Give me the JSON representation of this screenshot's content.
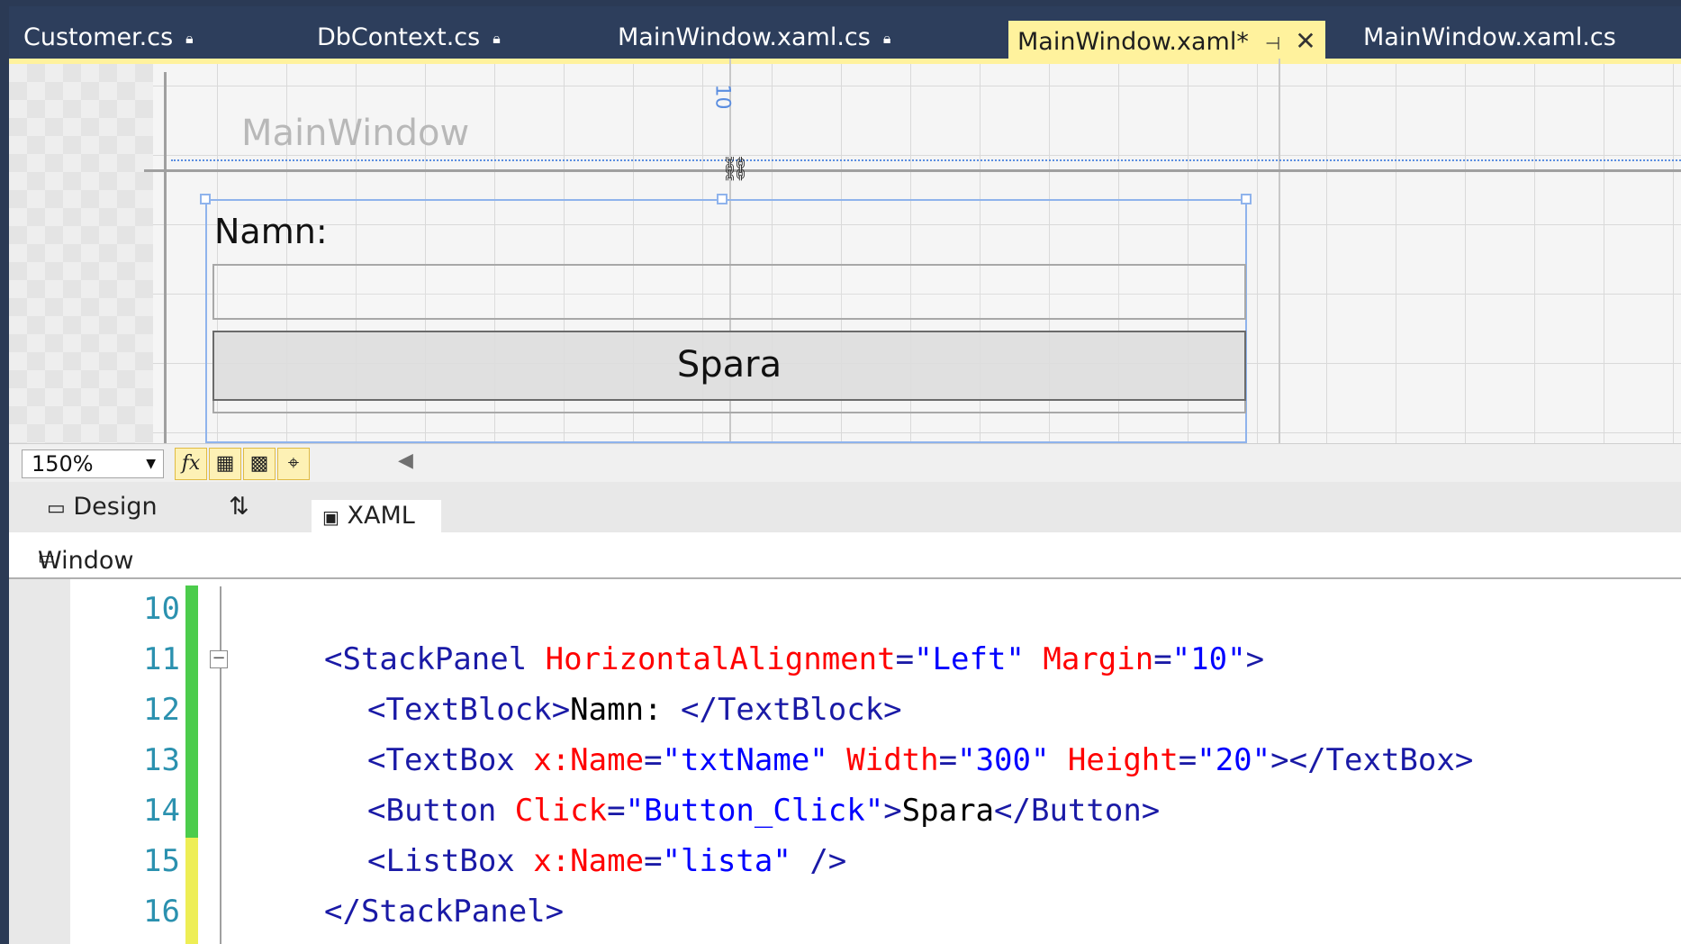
{
  "tabs": [
    {
      "label": "Customer.cs",
      "locked": true,
      "active": false
    },
    {
      "label": "DbContext.cs",
      "locked": true,
      "active": false
    },
    {
      "label": "MainWindow.xaml.cs",
      "locked": true,
      "active": false
    },
    {
      "label": "MainWindow.xaml*",
      "locked": false,
      "active": true
    },
    {
      "label": "MainWindow.xaml.cs",
      "locked": false,
      "active": false
    }
  ],
  "designer": {
    "window_title": "MainWindow",
    "margin_label": "10",
    "textblock_text": "Namn:",
    "button_text": "Spara"
  },
  "toolbar": {
    "zoom": "150%",
    "fx_label": "fx"
  },
  "view_tabs": {
    "design": "Design",
    "swap": "⇅",
    "xaml": "XAML"
  },
  "breadcrumb": {
    "label": "Window"
  },
  "code": {
    "lines": [
      {
        "number": "10",
        "change": "green"
      },
      {
        "number": "11",
        "change": "green"
      },
      {
        "number": "12",
        "change": "green"
      },
      {
        "number": "13",
        "change": "green"
      },
      {
        "number": "14",
        "change": "green"
      },
      {
        "number": "15",
        "change": "yellow"
      },
      {
        "number": "16",
        "change": "yellow"
      }
    ],
    "l11": {
      "open": "<StackPanel",
      "a1": " HorizontalAlignment",
      "eq1": "=",
      "v1": "\"Left\"",
      "a2": " Margin",
      "eq2": "=",
      "v2": "\"10\"",
      "close": ">"
    },
    "l12": {
      "open": "<TextBlock>",
      "text": "Namn: ",
      "close": "</TextBlock>"
    },
    "l13": {
      "open": "<TextBox",
      "a1": " x:Name",
      "eq1": "=",
      "v1": "\"txtName\"",
      "a2": " Width",
      "eq2": "=",
      "v2": "\"300\"",
      "a3": " Height",
      "eq3": "=",
      "v3": "\"20\"",
      "close": "></TextBox>"
    },
    "l14": {
      "open": "<Button",
      "a1": " Click",
      "eq1": "=",
      "v1": "\"Button_Click\"",
      "mid": ">",
      "text": "Spara",
      "close": "</Button>"
    },
    "l15": {
      "open": "<ListBox",
      "a1": " x:Name",
      "eq1": "=",
      "v1": "\"lista\"",
      "close": " />"
    },
    "l16": {
      "close": "</StackPanel>"
    }
  },
  "colors": {
    "tab_strip": "#2d3e5c",
    "active_tab": "#fff29d",
    "change_saved": "#4ccc4c",
    "change_unsaved": "#eeee55"
  }
}
